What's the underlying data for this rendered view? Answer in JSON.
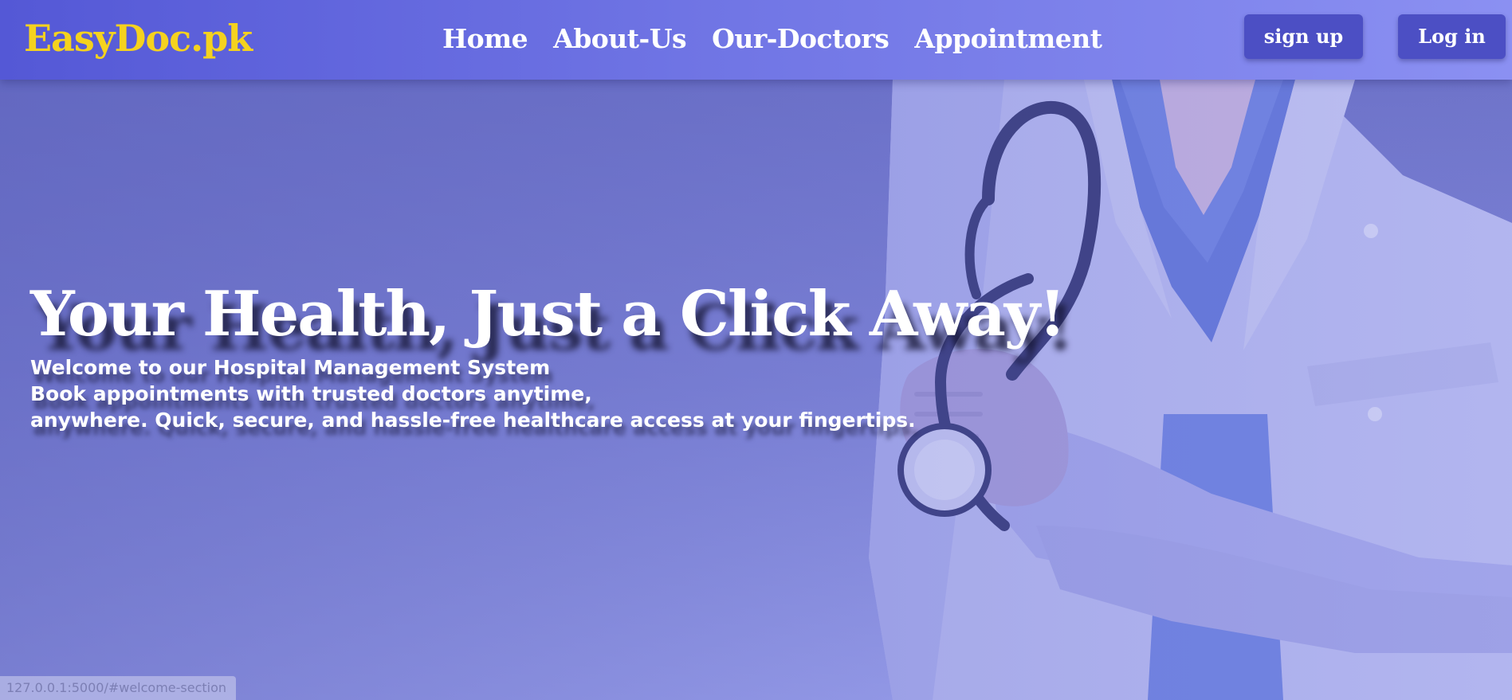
{
  "navbar": {
    "brand": "EasyDoc.pk",
    "links": [
      "Home",
      "About-Us",
      "Our-Doctors",
      "Appointment"
    ],
    "signup_label": "sign up",
    "login_label": "Log in"
  },
  "hero": {
    "title": "Your Health, Just a Click Away!",
    "subtitle_lines": [
      "Welcome to our Hospital Management System",
      "Book appointments with trusted doctors anytime,",
      "anywhere. Quick, secure, and hassle-free healthcare access at your fingertips."
    ],
    "photo_icon": "doctor-with-stethoscope-photo"
  },
  "status_bar": {
    "url": "127.0.0.1:5000/#welcome-section"
  },
  "colors": {
    "brand": "#f5d21e",
    "nav_gradient_start": "#5458d6",
    "nav_gradient_end": "#8b90f2",
    "button_bg": "#4c4fc4",
    "hero_bg": "#7a80d3"
  }
}
